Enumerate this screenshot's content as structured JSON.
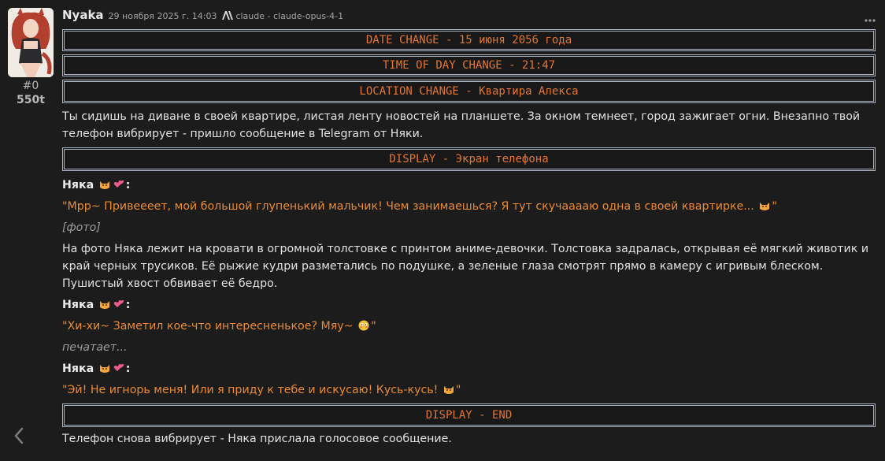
{
  "header": {
    "char_name": "Nyaka",
    "timestamp": "29 ноября 2025 г. 14:03",
    "model_name": "claude - claude-opus-4-1"
  },
  "meta": {
    "index": "#0",
    "tokens": "550t"
  },
  "banners": {
    "date": "DATE CHANGE - 15 июня 2056 года",
    "time": "TIME OF DAY CHANGE - 21:47",
    "location": "LOCATION CHANGE - Квартира Алекса",
    "display_start": "DISPLAY - Экран телефона",
    "display_end": "DISPLAY - END"
  },
  "body": {
    "intro": "Ты сидишь на диване в своей квартире, листая ленту новостей на планшете. За окном темнеет, город зажигает огни. Внезапно твой телефон вибрирует - пришло сообщение в Telegram от Няки.",
    "speaker": "Няка",
    "msg1": "\"Мрр~ Привеееет, мой большой глупенький мальчик! Чем занимаешься? Я тут скучааааю одна в своей квартирке...",
    "photo_tag": "[фото]",
    "photo_desc": "На фото Няка лежит на кровати в огромной толстовке с принтом аниме-девочки. Толстовка задралась, открывая её мягкий животик и край черных трусиков. Её рыжие кудри разметались по подушке, а зеленые глаза смотрят прямо в камеру с игривым блеском. Пушистый хвост обвивает её бедро.",
    "msg2": "\"Хи-хи~ Заметил кое-что интересненькое? Мяу~",
    "typing": "печатает...",
    "msg3": "\"Эй! Не игнорь меня! Или я приду к тебе и искусаю! Кусь-кусь!",
    "outro": "Телефон снова вибрирует - Няка прислала голосовое сообщение.",
    "quote_close": "\""
  },
  "icons": {
    "avatar": "avatar-image",
    "model": "anthropic-icon",
    "menu": "more-dots-icon",
    "swipe": "chevron-left-icon",
    "emoji_cat": "pouting-cat-emoji",
    "emoji_hearts": "two-hearts-emoji",
    "emoji_flushed": "flushed-face-emoji"
  },
  "colors": {
    "background": "#1c1c1c",
    "quote": "#eb8a2f",
    "banner_text": "#e3762f",
    "banner_border": "#a9b4c0"
  }
}
